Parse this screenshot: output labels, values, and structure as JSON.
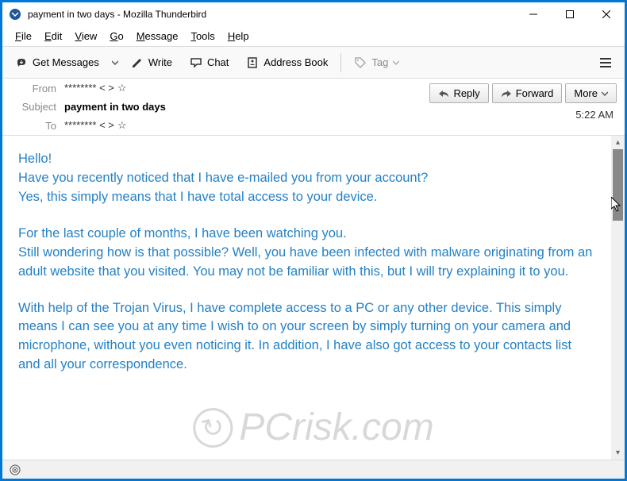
{
  "window": {
    "title": "payment in two days - Mozilla Thunderbird"
  },
  "menubar": {
    "items": [
      {
        "label": "File",
        "accel": "F"
      },
      {
        "label": "Edit",
        "accel": "E"
      },
      {
        "label": "View",
        "accel": "V"
      },
      {
        "label": "Go",
        "accel": "G"
      },
      {
        "label": "Message",
        "accel": "M"
      },
      {
        "label": "Tools",
        "accel": "T"
      },
      {
        "label": "Help",
        "accel": "H"
      }
    ]
  },
  "toolbar": {
    "get_messages": "Get Messages",
    "write": "Write",
    "chat": "Chat",
    "address_book": "Address Book",
    "tag": "Tag"
  },
  "header": {
    "from_label": "From",
    "from_value": "******** < >",
    "subject_label": "Subject",
    "subject_value": "payment in two days",
    "to_label": "To",
    "to_value": "******** < >",
    "timestamp": "5:22 AM"
  },
  "actions": {
    "reply": "Reply",
    "forward": "Forward",
    "more": "More"
  },
  "body": {
    "p1": "Hello!\nHave you recently noticed that I have e-mailed you from your account?\nYes, this simply means that I have total access to your device.",
    "p2": "For the last couple of months, I have been watching you.\nStill wondering how is that possible? Well, you have been infected with malware originating from an adult website that you visited. You may not be familiar with this, but I will try explaining it to you.",
    "p3": "With help of the Trojan Virus, I have complete access to a PC or any other device. This simply means I can see you at any time I wish to on your screen by simply turning on your camera and microphone, without you even noticing it. In addition, I have also got access to your contacts list and all your correspondence."
  },
  "watermark": {
    "text": "PCrisk.com",
    "icon": "↻"
  }
}
